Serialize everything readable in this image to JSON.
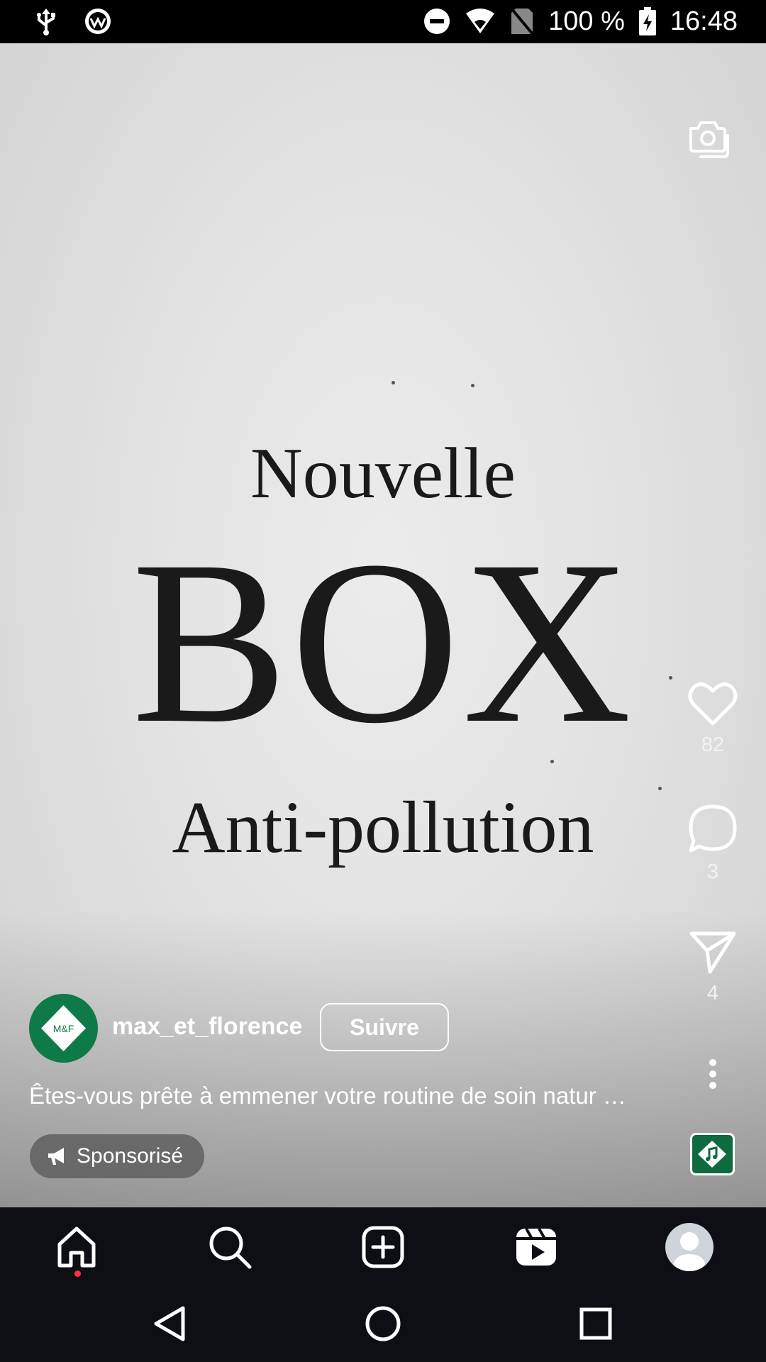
{
  "status_bar": {
    "battery_percent": "100 %",
    "time": "16:48",
    "icons": [
      "usb-icon",
      "app-notification-icon",
      "do-not-disturb-icon",
      "wifi-icon",
      "no-sim-icon",
      "battery-charging-icon"
    ]
  },
  "reel": {
    "headline_line1": "Nouvelle",
    "headline_line2": "BOX",
    "headline_line3": "Anti-pollution",
    "background_color": "#e4e4e4",
    "text_color": "#1a1a1a"
  },
  "actions": {
    "likes": "82",
    "comments": "3",
    "shares": "4"
  },
  "creator": {
    "avatar_text": "M&F",
    "username": "max_et_florence",
    "follow_label": "Suivre",
    "brand_color": "#0e7a47"
  },
  "caption": "Êtes-vous prête à emmener votre routine de soin natur …",
  "sponsored_label": "Sponsorisé",
  "bottom_nav": {
    "items": [
      "home-icon",
      "search-icon",
      "create-icon",
      "reels-icon",
      "profile-avatar"
    ],
    "active": "home-icon",
    "notification_dot_color": "#ff3040"
  },
  "system_nav": [
    "back-button",
    "home-button",
    "recents-button"
  ]
}
